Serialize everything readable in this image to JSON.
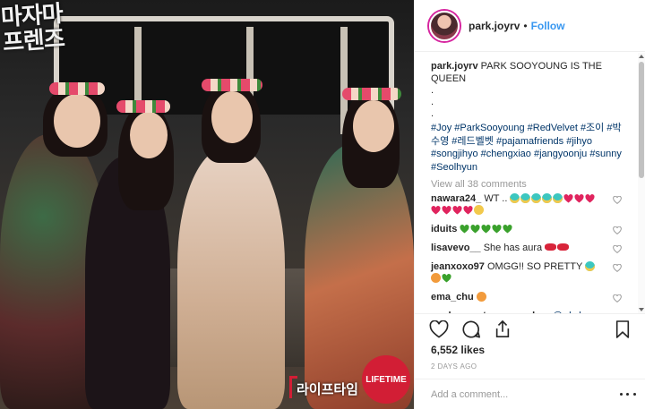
{
  "photo": {
    "overlay_logo": "마자마\n프렌즈",
    "korean_tag": "라이프타임",
    "channel_badge": "LIFETIME"
  },
  "header": {
    "username": "park.joyrv",
    "separator": "•",
    "follow_label": "Follow"
  },
  "caption": {
    "username": "park.joyrv",
    "text": "PARK SOOYOUNG IS THE QUEEN",
    "dots": [
      ".",
      ".",
      "."
    ],
    "hashtags": "#Joy #ParkSooyoung #RedVelvet #조이 #박수영 #레드벨벳 #pajamafriends #jihyo #songjihyo #chengxiao #jangyoonju #sunny #Seolhyun"
  },
  "view_all_label": "View all 38 comments",
  "comments": [
    {
      "user": "nawara24_",
      "text": "WT ..",
      "emojis": [
        "cry",
        "cry",
        "cry",
        "cry",
        "cry",
        "heart",
        "heart",
        "heart",
        "heart",
        "heart",
        "heart",
        "heart",
        "grin"
      ]
    },
    {
      "user": "iduits",
      "text": "",
      "emojis": [
        "gheart",
        "gheart",
        "gheart",
        "gheart",
        "gheart"
      ]
    },
    {
      "user": "lisavevo__",
      "text": "She has aura",
      "emojis": [
        "lips",
        "lips"
      ]
    },
    {
      "user": "jeanxoxo97",
      "text": "OMGG!! SO PRETTY",
      "emojis": [
        "cry",
        "eyes",
        "gheart"
      ]
    },
    {
      "user": "ema_chu",
      "text": "",
      "emojis": [
        "eyes"
      ]
    },
    {
      "user": "panko_ganteng_ganabap",
      "text": "",
      "mention": "@rd.shann"
    }
  ],
  "actions": {
    "like_icon": "heart-outline-icon",
    "comment_icon": "comment-bubble-icon",
    "share_icon": "share-icon",
    "save_icon": "bookmark-icon"
  },
  "likes_label": "6,552 likes",
  "timestamp": "2 DAYS AGO",
  "add_comment": {
    "placeholder": "Add a comment...",
    "more_icon": "more-options-icon"
  },
  "colors": {
    "link": "#003569",
    "follow": "#3897f0",
    "muted": "#999999",
    "badge": "#d21e35"
  }
}
